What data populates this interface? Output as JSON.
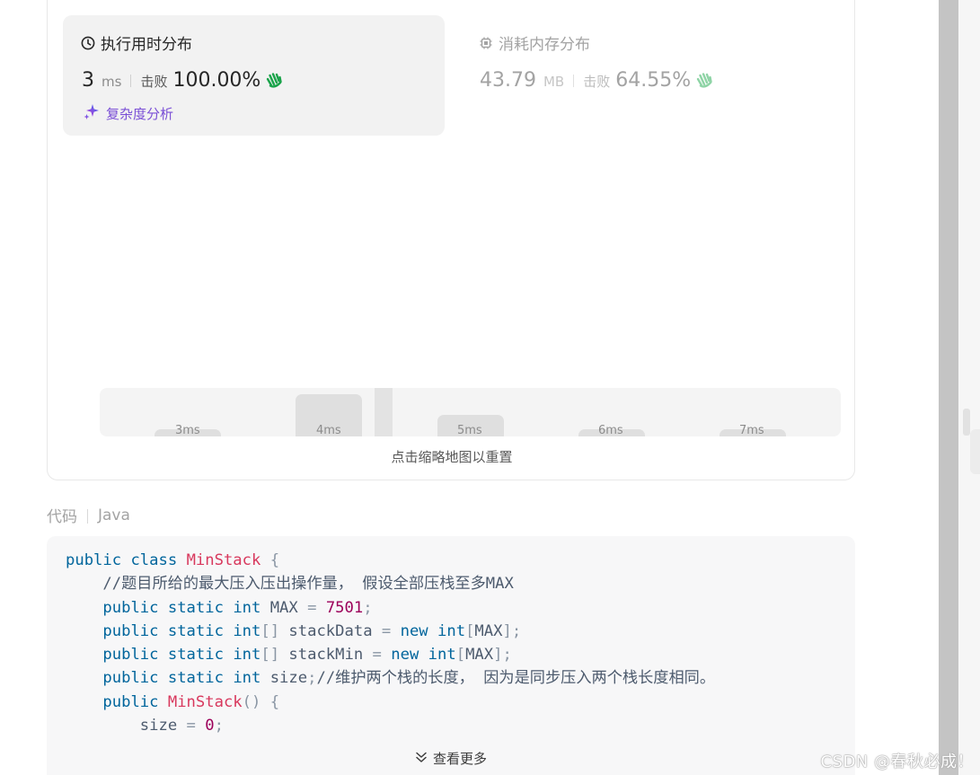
{
  "runtime": {
    "title": "执行用时分布",
    "value": "3",
    "unit": "ms",
    "beat_label": "击败",
    "beat_percent": "100.00%",
    "analysis_link": "复杂度分析"
  },
  "memory": {
    "title": "消耗内存分布",
    "value": "43.79",
    "unit": "MB",
    "beat_label": "击败",
    "beat_percent": "64.55%"
  },
  "minimap": {
    "labels": [
      "3ms",
      "4ms",
      "5ms",
      "6ms",
      "7ms"
    ],
    "hint": "点击缩略地图以重置"
  },
  "code_section": {
    "label": "代码",
    "language": "Java",
    "show_more": "查看更多",
    "lines": [
      [
        [
          "kw",
          "public"
        ],
        [
          "t",
          " "
        ],
        [
          "kw",
          "class"
        ],
        [
          "t",
          " "
        ],
        [
          "cls",
          "MinStack"
        ],
        [
          "t",
          " "
        ],
        [
          "pun",
          "{"
        ]
      ],
      [
        [
          "t",
          "    "
        ],
        [
          "cmt",
          "//题目所给的最大压入压出操作量， 假设全部压栈至多MAX"
        ]
      ],
      [
        [
          "t",
          "    "
        ],
        [
          "kw",
          "public"
        ],
        [
          "t",
          " "
        ],
        [
          "kw",
          "static"
        ],
        [
          "t",
          " "
        ],
        [
          "kw",
          "int"
        ],
        [
          "t",
          " MAX "
        ],
        [
          "pun",
          "="
        ],
        [
          "t",
          " "
        ],
        [
          "num",
          "7501"
        ],
        [
          "pun",
          ";"
        ]
      ],
      [
        [
          "t",
          "    "
        ],
        [
          "kw",
          "public"
        ],
        [
          "t",
          " "
        ],
        [
          "kw",
          "static"
        ],
        [
          "t",
          " "
        ],
        [
          "kw",
          "int"
        ],
        [
          "pun",
          "[]"
        ],
        [
          "t",
          " stackData "
        ],
        [
          "pun",
          "="
        ],
        [
          "t",
          " "
        ],
        [
          "kw",
          "new"
        ],
        [
          "t",
          " "
        ],
        [
          "kw",
          "int"
        ],
        [
          "pun",
          "["
        ],
        [
          "t",
          "MAX"
        ],
        [
          "pun",
          "];"
        ]
      ],
      [
        [
          "t",
          "    "
        ],
        [
          "kw",
          "public"
        ],
        [
          "t",
          " "
        ],
        [
          "kw",
          "static"
        ],
        [
          "t",
          " "
        ],
        [
          "kw",
          "int"
        ],
        [
          "pun",
          "[]"
        ],
        [
          "t",
          " stackMin "
        ],
        [
          "pun",
          "="
        ],
        [
          "t",
          " "
        ],
        [
          "kw",
          "new"
        ],
        [
          "t",
          " "
        ],
        [
          "kw",
          "int"
        ],
        [
          "pun",
          "["
        ],
        [
          "t",
          "MAX"
        ],
        [
          "pun",
          "];"
        ]
      ],
      [
        [
          "t",
          "    "
        ],
        [
          "kw",
          "public"
        ],
        [
          "t",
          " "
        ],
        [
          "kw",
          "static"
        ],
        [
          "t",
          " "
        ],
        [
          "kw",
          "int"
        ],
        [
          "t",
          " size"
        ],
        [
          "pun",
          ";"
        ],
        [
          "cmt",
          "//维护两个栈的长度， 因为是同步压入两个栈长度相同。"
        ]
      ],
      [
        [
          "t",
          "    "
        ],
        [
          "kw",
          "public"
        ],
        [
          "t",
          " "
        ],
        [
          "cls",
          "MinStack"
        ],
        [
          "pun",
          "()"
        ],
        [
          "t",
          " "
        ],
        [
          "pun",
          "{"
        ]
      ],
      [
        [
          "t",
          "        size "
        ],
        [
          "pun",
          "="
        ],
        [
          "t",
          " "
        ],
        [
          "num",
          "0"
        ],
        [
          "pun",
          ";"
        ]
      ]
    ]
  },
  "watermark": "CSDN @春秋必成！",
  "colors": {
    "accent_purple": "#7a4fd6",
    "hand_green": "#1aa34a",
    "hand_green_faded": "#8fd4a6",
    "keyword": "#00659c",
    "class_name": "#d8385d",
    "number": "#9c005a"
  }
}
